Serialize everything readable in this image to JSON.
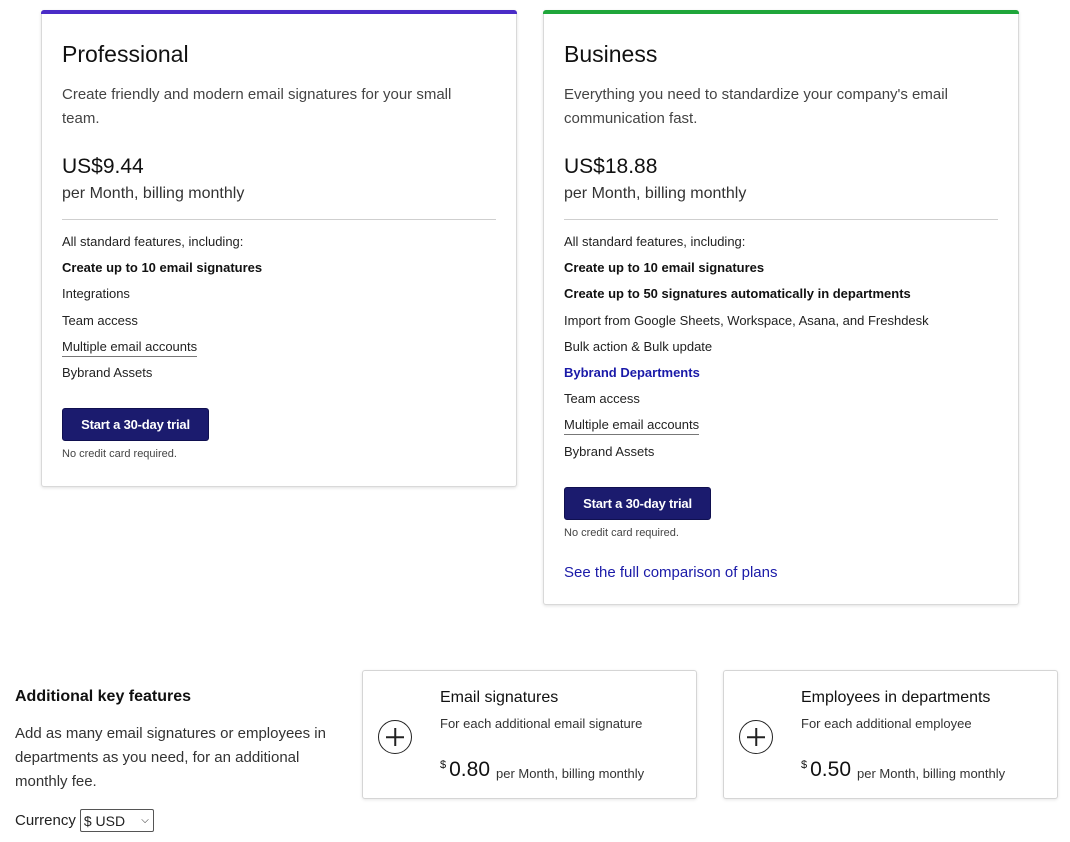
{
  "colors": {
    "professional_accent": "#4a2cc7",
    "business_accent": "#1fa63a",
    "button_bg": "#1b1b6e",
    "link": "#1a1aa8"
  },
  "plans": [
    {
      "title": "Professional",
      "description": "Create friendly and modern email signatures for your small team.",
      "price": "US$9.44",
      "period": "per Month, billing monthly",
      "features_heading": "All standard features, including:",
      "features": [
        "Create up to 10 email signatures",
        "Integrations",
        "Team access",
        "Multiple email accounts",
        "Bybrand Assets"
      ],
      "cta_label": "Start a 30-day trial",
      "no_credit_card": "No credit card required."
    },
    {
      "title": "Business",
      "description": "Everything you need to standardize your company's email communication fast.",
      "price": "US$18.88",
      "period": "per Month, billing monthly",
      "features_heading": "All standard features, including:",
      "features": [
        "Create up to 10 email signatures",
        "Create up to 50 signatures automatically in departments",
        "Import from Google Sheets, Workspace, Asana, and Freshdesk",
        "Bulk action & Bulk update",
        "Bybrand Departments",
        "Team access",
        "Multiple email accounts",
        "Bybrand Assets"
      ],
      "cta_label": "Start a 30-day trial",
      "no_credit_card": "No credit card required.",
      "compare_link": "See the full comparison of plans"
    }
  ],
  "additional": {
    "title": "Additional key features",
    "description": "Add as many email signatures or employees in departments as you need, for an additional monthly fee.",
    "currency_label": "Currency",
    "currency_selected": "$ USD",
    "addons": [
      {
        "icon": "plus-circle-icon",
        "title": "Email signatures",
        "subtitle": "For each additional email signature",
        "currency_symbol": "$",
        "amount": "0.80",
        "period": "per Month, billing monthly"
      },
      {
        "icon": "plus-circle-icon",
        "title": "Employees in departments",
        "subtitle": "For each additional employee",
        "currency_symbol": "$",
        "amount": "0.50",
        "period": "per Month, billing monthly"
      }
    ]
  }
}
